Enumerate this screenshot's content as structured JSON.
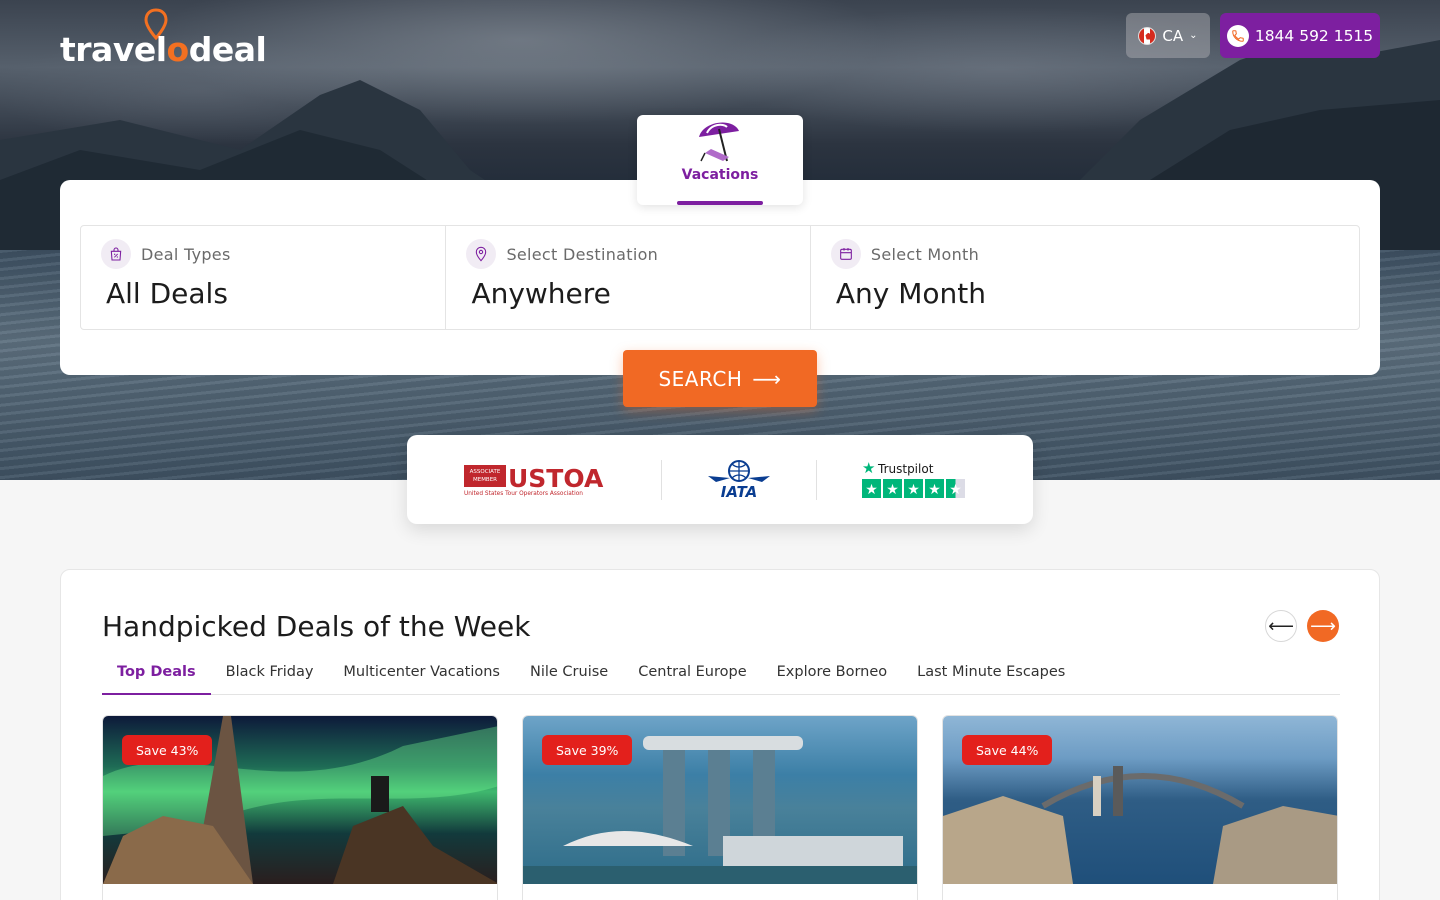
{
  "header": {
    "logo_text_pre": "travel",
    "logo_text_o": "o",
    "logo_text_post": "deal",
    "country": "CA",
    "phone": "1844 592 1515"
  },
  "vacation_tab": {
    "label": "Vacations"
  },
  "search": {
    "fields": [
      {
        "label": "Deal Types",
        "value": "All Deals",
        "icon": "discount-bag-icon"
      },
      {
        "label": "Select Destination",
        "value": "Anywhere",
        "icon": "location-pin-icon"
      },
      {
        "label": "Select Month",
        "value": "Any Month",
        "icon": "calendar-icon"
      }
    ],
    "button_label": "SEARCH"
  },
  "trust": {
    "ustoa_badge_top": "ASSOCIATE",
    "ustoa_badge_bottom": "MEMBER",
    "ustoa_name": "USTOA",
    "ustoa_sub": "United States Tour Operators Association",
    "iata": "IATA",
    "trustpilot": "Trustpilot",
    "trustpilot_rating": 4.5
  },
  "deals": {
    "title": "Handpicked Deals of the Week",
    "tabs": [
      "Top Deals",
      "Black Friday",
      "Multicenter Vacations",
      "Nile Cruise",
      "Central Europe",
      "Explore Borneo",
      "Last Minute Escapes"
    ],
    "active_tab": "Top Deals",
    "cards": [
      {
        "badge": "Save 43%"
      },
      {
        "badge": "Save 39%"
      },
      {
        "badge": "Save 44%"
      }
    ]
  },
  "colors": {
    "brand_purple": "#7d1fa0",
    "accent_orange": "#f16924",
    "badge_red": "#e3201c"
  }
}
